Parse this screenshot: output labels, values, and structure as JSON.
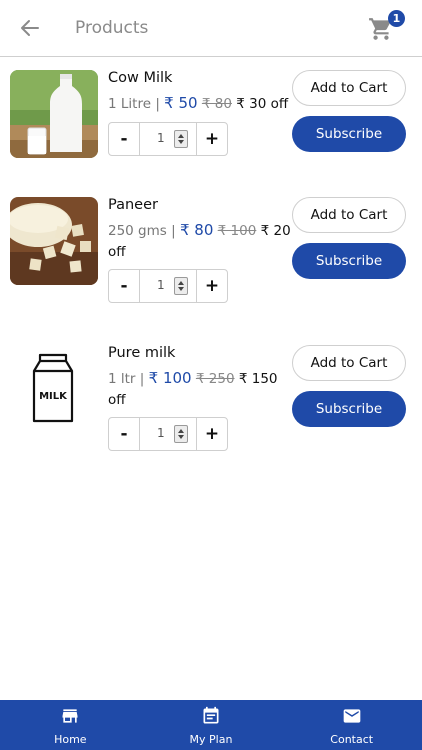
{
  "header": {
    "title": "Products",
    "cart_count": "1",
    "back_icon": "arrow-left-icon",
    "cart_icon": "cart-icon"
  },
  "products": [
    {
      "name": "Cow Milk",
      "unit": "1 Litre",
      "separator": "|",
      "price": "₹ 50",
      "mrp": "₹ 80",
      "off": "₹ 30 off",
      "quantity": "1",
      "add_to_cart": "Add to Cart",
      "subscribe": "Subscribe"
    },
    {
      "name": "Paneer",
      "unit": "250 gms",
      "separator": "|",
      "price": "₹ 80",
      "mrp": "₹ 100",
      "off": "₹ 20 off",
      "quantity": "1",
      "add_to_cart": "Add to Cart",
      "subscribe": "Subscribe"
    },
    {
      "name": "Pure milk",
      "unit": "1 ltr",
      "separator": "|",
      "price": "₹ 100",
      "mrp": "₹ 250",
      "off": "₹ 150 off",
      "quantity": "1",
      "add_to_cart": "Add to Cart",
      "subscribe": "Subscribe",
      "carton_label": "MILK"
    }
  ],
  "stepper": {
    "minus": "-",
    "plus": "+"
  },
  "bottom_nav": [
    {
      "label": "Home",
      "icon": "store-icon"
    },
    {
      "label": "My Plan",
      "icon": "calendar-icon"
    },
    {
      "label": "Contact",
      "icon": "mail-icon"
    }
  ],
  "colors": {
    "accent": "#1f4aa8",
    "muted": "#888888",
    "border": "#cfcfcf"
  }
}
